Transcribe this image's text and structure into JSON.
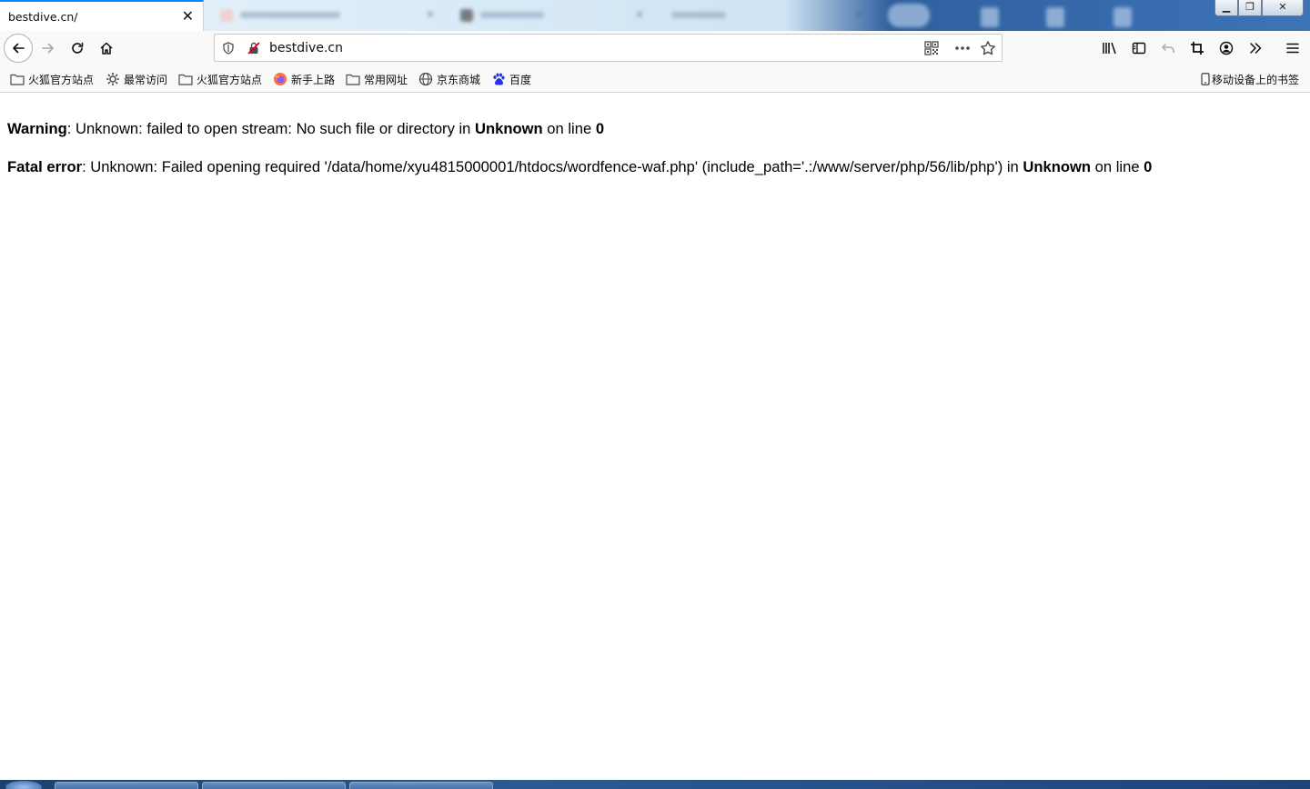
{
  "window": {
    "active_tab_title": "bestdive.cn/",
    "background_tabs": [
      {
        "favicon_color": "#d9534f"
      },
      {
        "favicon_color": "#3b3b3b"
      },
      {
        "favicon_color": "#5b8fd6"
      }
    ],
    "controls": {
      "minimize": "▁",
      "maximize": "❐",
      "close": "✕"
    }
  },
  "toolbar": {
    "url": "bestdive.cn"
  },
  "bookmarks": {
    "items": [
      {
        "label": "火狐官方站点",
        "icon": "folder-icon"
      },
      {
        "label": "最常访问",
        "icon": "gear-icon"
      },
      {
        "label": "火狐官方站点",
        "icon": "folder-icon"
      },
      {
        "label": "新手上路",
        "icon": "firefox-icon"
      },
      {
        "label": "常用网址",
        "icon": "folder-icon"
      },
      {
        "label": "京东商城",
        "icon": "globe-icon"
      },
      {
        "label": "百度",
        "icon": "baidu-paw-icon"
      }
    ],
    "mobile": {
      "label": "移动设备上的书签",
      "icon": "mobile-icon"
    }
  },
  "page": {
    "warning": {
      "label": "Warning",
      "message": ": Unknown: failed to open stream: No such file or directory in ",
      "location": "Unknown",
      "on_line": " on line ",
      "line": "0"
    },
    "fatal": {
      "label": "Fatal error",
      "message": ": Unknown: Failed opening required '/data/home/xyu4815000001/htdocs/wordfence-waf.php' (include_path='.:/www/server/php/56/lib/php') in ",
      "location": "Unknown",
      "on_line": " on line ",
      "line": "0"
    }
  },
  "colors": {
    "accent": "#0a84ff",
    "toolbar_bg": "#f9f9fa",
    "taskbar": "#2b5a93"
  }
}
